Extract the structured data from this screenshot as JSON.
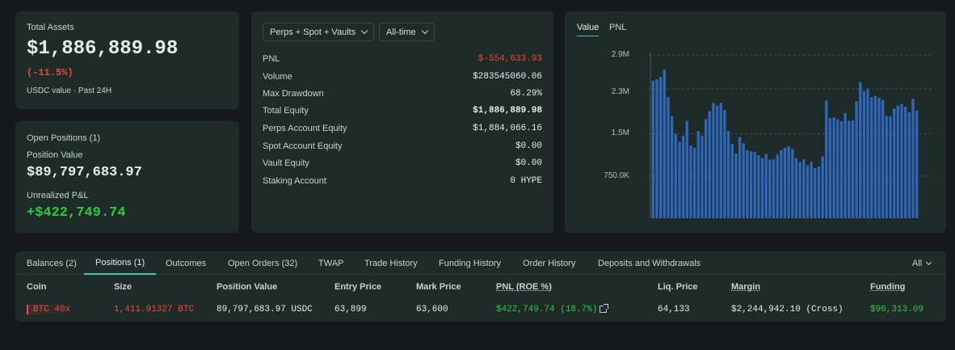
{
  "assets": {
    "label": "Total Assets",
    "value": "$1,886,889.98",
    "change": "(-11.5%)",
    "sub": "USDC value · Past 24H"
  },
  "open_positions": {
    "title": "Open Positions (1)",
    "position_value_label": "Position Value",
    "position_value": "$89,797,683.97",
    "unrealized_label": "Unrealized P&L",
    "unrealized_value": "+$422,749.74"
  },
  "stats": {
    "filter_market": "Perps + Spot + Vaults",
    "filter_time": "All-time",
    "rows": [
      {
        "label": "PNL",
        "value": "$-554,633.93"
      },
      {
        "label": "Volume",
        "value": "$283545060.06"
      },
      {
        "label": "Max Drawdown",
        "value": "68.29%"
      },
      {
        "label": "Total Equity",
        "value": "$1,886,889.98"
      },
      {
        "label": "Perps Account Equity",
        "value": "$1,884,066.16"
      },
      {
        "label": "Spot Account Equity",
        "value": "$0.00"
      },
      {
        "label": "Vault Equity",
        "value": "$0.00"
      },
      {
        "label": "Staking Account",
        "value": "0 HYPE"
      }
    ]
  },
  "chart_tabs": {
    "value": "Value",
    "pnl": "PNL"
  },
  "chart_data": {
    "type": "bar",
    "ylim": [
      0,
      2900000
    ],
    "yticks": [
      {
        "value": 2900000,
        "label": "2.9M"
      },
      {
        "value": 2300000,
        "label": "2.3M"
      },
      {
        "value": 1500000,
        "label": "1.5M"
      },
      {
        "value": 750000,
        "label": "750.0K"
      }
    ],
    "grid": true,
    "values": [
      2440000,
      2470000,
      2510000,
      2640000,
      2150000,
      1810000,
      1500000,
      1360000,
      1460000,
      1730000,
      1290000,
      1250000,
      1550000,
      1470000,
      1760000,
      1900000,
      2050000,
      2000000,
      2050000,
      1920000,
      1550000,
      1320000,
      1150000,
      1440000,
      1330000,
      1210000,
      1190000,
      1180000,
      1120000,
      1070000,
      1140000,
      1040000,
      1050000,
      1130000,
      1210000,
      1250000,
      1280000,
      1230000,
      1070000,
      1000000,
      1050000,
      940000,
      1000000,
      890000,
      920000,
      1100000,
      2090000,
      1780000,
      1790000,
      1760000,
      1720000,
      1870000,
      1730000,
      1740000,
      2080000,
      2420000,
      2260000,
      2300000,
      2150000,
      2170000,
      2140000,
      2100000,
      1820000,
      1810000,
      1950000,
      2000000,
      2030000,
      1980000,
      1880000,
      2120000,
      1910000
    ]
  },
  "tabs": [
    {
      "label": "Balances (2)",
      "active": false
    },
    {
      "label": "Positions (1)",
      "active": true
    },
    {
      "label": "Outcomes",
      "active": false
    },
    {
      "label": "Open Orders (32)",
      "active": false
    },
    {
      "label": "TWAP",
      "active": false
    },
    {
      "label": "Trade History",
      "active": false
    },
    {
      "label": "Funding History",
      "active": false
    },
    {
      "label": "Order History",
      "active": false
    },
    {
      "label": "Deposits and Withdrawals",
      "active": false
    }
  ],
  "tab_filter": "All",
  "table": {
    "headers": [
      "Coin",
      "Size",
      "Position Value",
      "Entry Price",
      "Mark Price",
      "PNL (ROE %)",
      "Liq. Price",
      "Margin",
      "Funding"
    ],
    "row": {
      "coin": "BTC 40x",
      "size": "1,411.91327 BTC",
      "position_value": "89,797,683.97 USDC",
      "entry_price": "63,899",
      "mark_price": "63,600",
      "pnl": "$422,749.74 (18.7%)",
      "liq_price": "64,133",
      "margin": "$2,244,942.10 (Cross)",
      "funding": "$96,313.09"
    }
  },
  "colors": {
    "negative": "#ec4a3a",
    "positive": "#2ecb3c",
    "bar": "#2f67b8",
    "accent": "#4fc3b0"
  }
}
